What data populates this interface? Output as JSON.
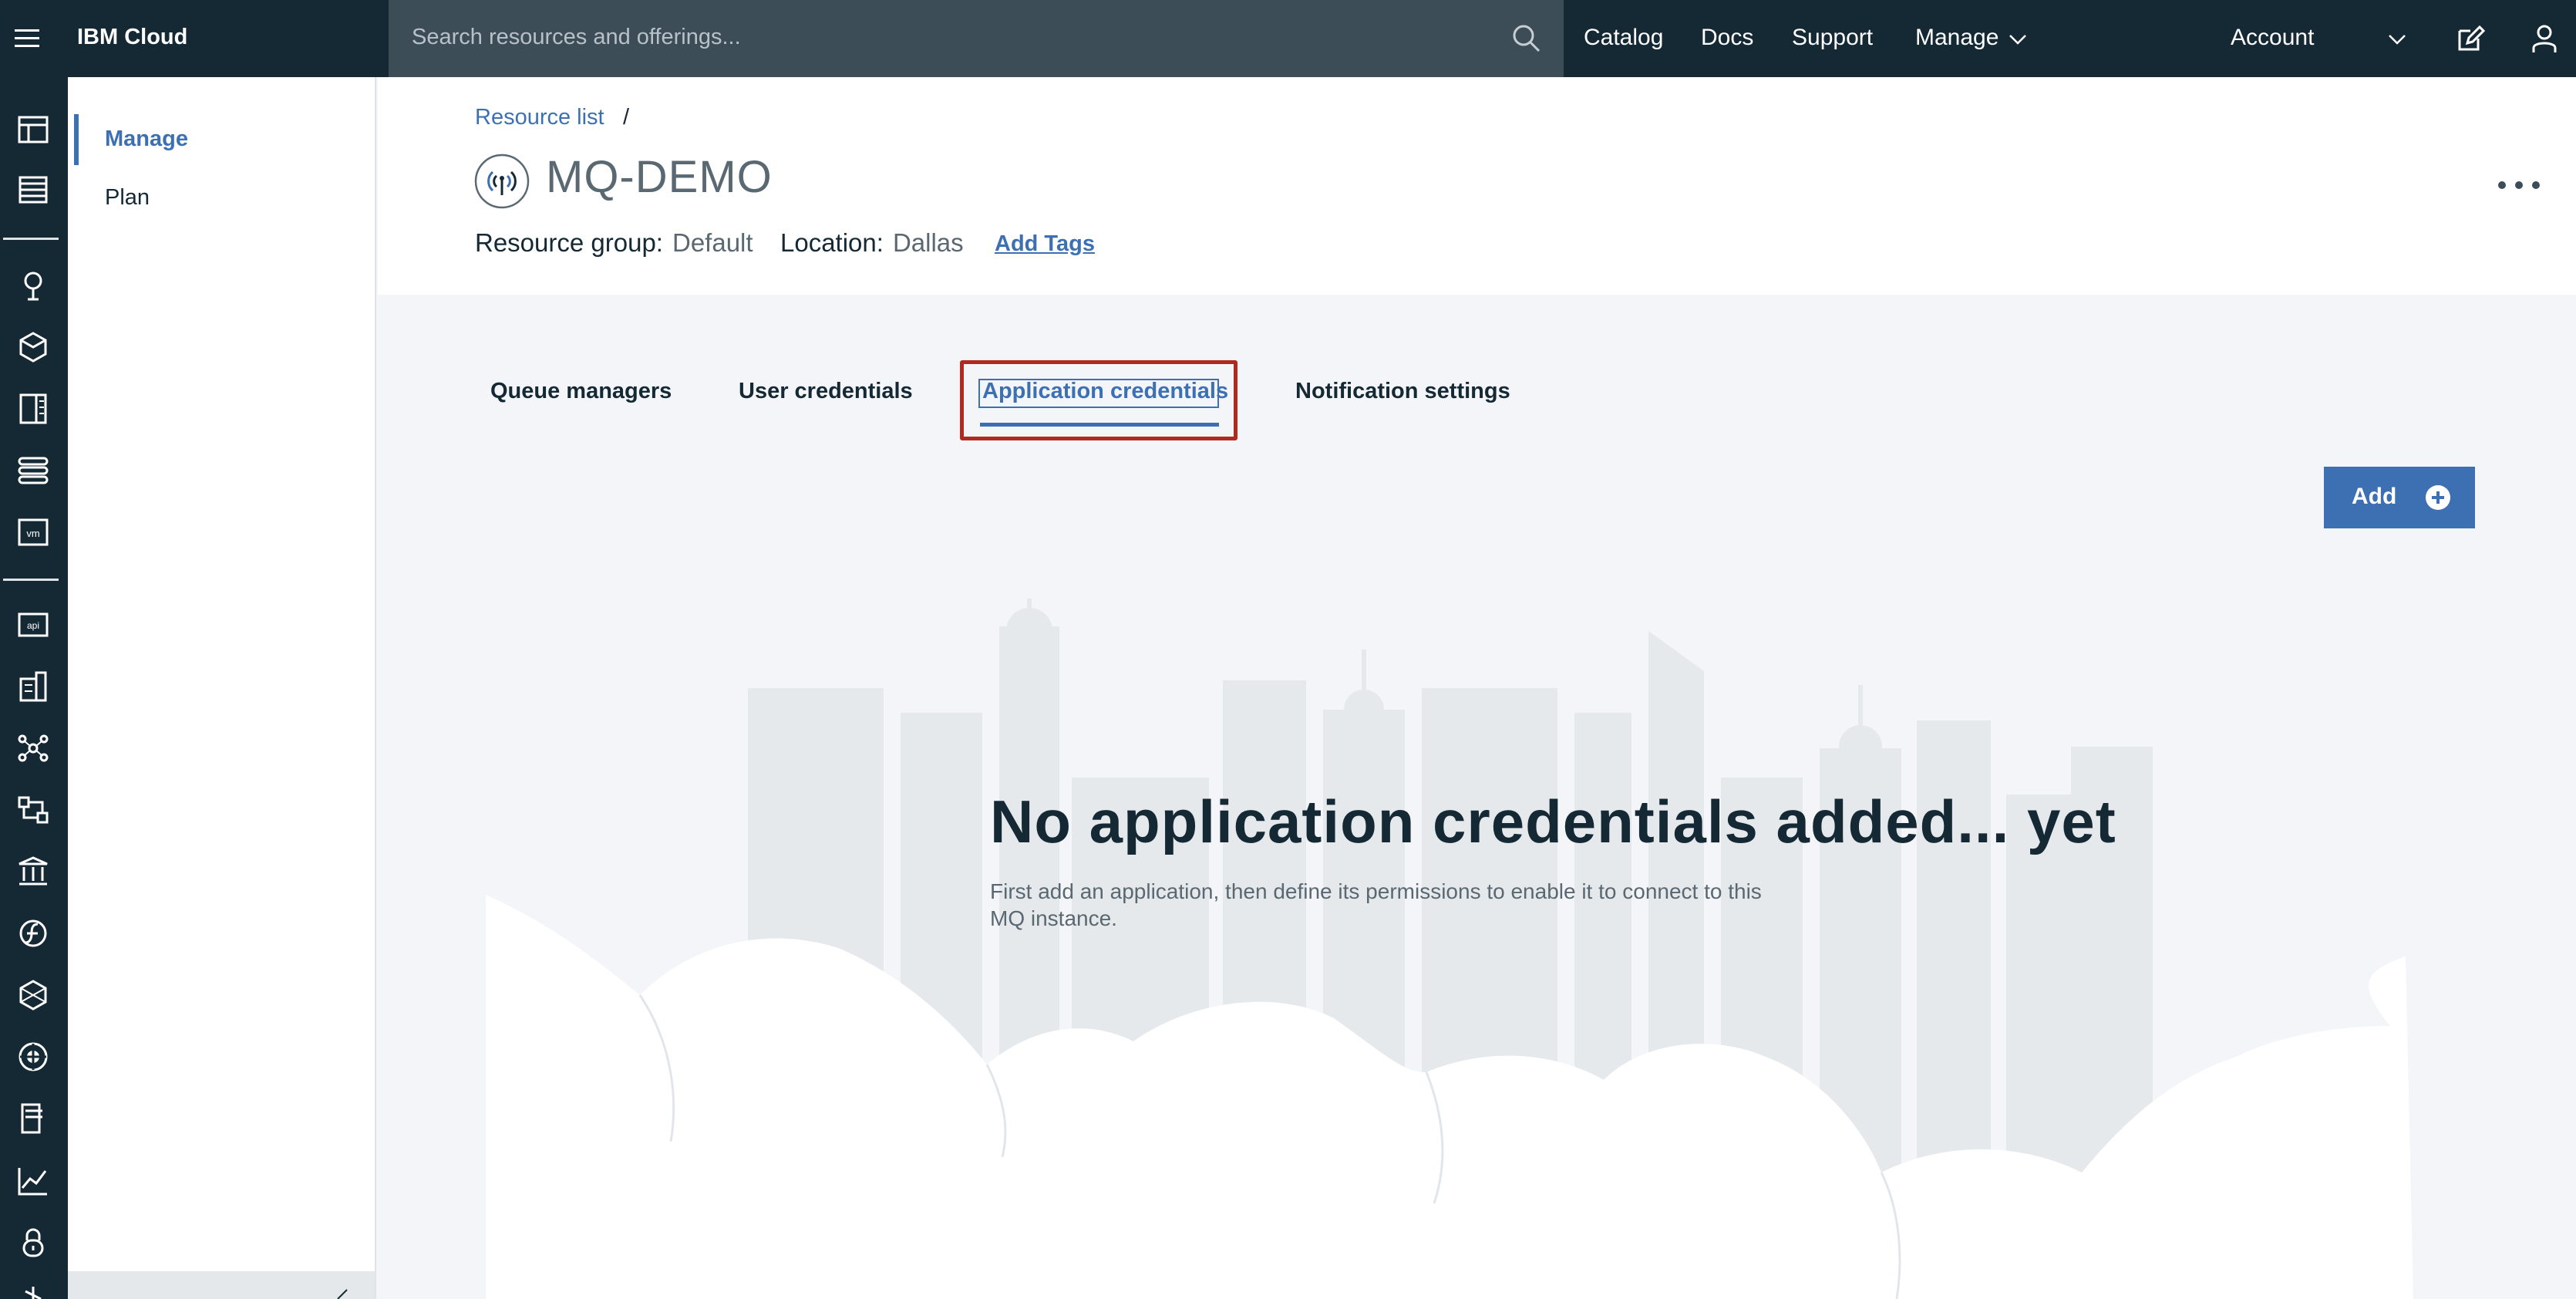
{
  "topbar": {
    "brand": "IBM Cloud",
    "search_placeholder": "Search resources and offerings...",
    "nav": {
      "catalog": "Catalog",
      "docs": "Docs",
      "support": "Support",
      "manage": "Manage"
    },
    "account": "Account",
    "icons": [
      "hamburger-menu-icon",
      "search-icon",
      "chevron-down-icon",
      "edit-icon",
      "user-icon"
    ]
  },
  "rail": {
    "icons": [
      "dashboard-icon",
      "resource-list-icon",
      "kubernetes-icon",
      "container-icon",
      "openshift-icon",
      "classic-infrastructure-icon",
      "vmware-icon",
      "api-icon",
      "cloud-foundry-icon",
      "ai-icon",
      "devops-icon",
      "blockchain-icon",
      "functions-icon",
      "integration-icon",
      "interconnectivity-icon",
      "mobile-icon",
      "observability-icon",
      "security-icon"
    ]
  },
  "sidebar": {
    "items": [
      {
        "label": "Manage",
        "active": true
      },
      {
        "label": "Plan",
        "active": false
      }
    ]
  },
  "header": {
    "breadcrumb": {
      "link": "Resource list",
      "separator": "/"
    },
    "title": "MQ-DEMO",
    "resource_group_label": "Resource group:",
    "resource_group_value": "Default",
    "location_label": "Location:",
    "location_value": "Dallas",
    "add_tags": "Add Tags",
    "service_icon": "mq-service-icon",
    "overflow_icon": "overflow-menu-icon"
  },
  "tabs": [
    {
      "label": "Queue managers",
      "active": false
    },
    {
      "label": "User credentials",
      "active": false
    },
    {
      "label": "Application credentials",
      "active": true
    },
    {
      "label": "Notification settings",
      "active": false
    }
  ],
  "add_button": {
    "label": "Add",
    "icon": "add-circle-icon"
  },
  "empty_state": {
    "title": "No application credentials added... yet",
    "description": "First add an application, then define its permissions to enable it to connect to this MQ instance."
  },
  "colors": {
    "topbar": "#152935",
    "accent": "#3d70b2",
    "highlight_box": "#b02a1e",
    "page_bg": "#f3f5f8"
  }
}
